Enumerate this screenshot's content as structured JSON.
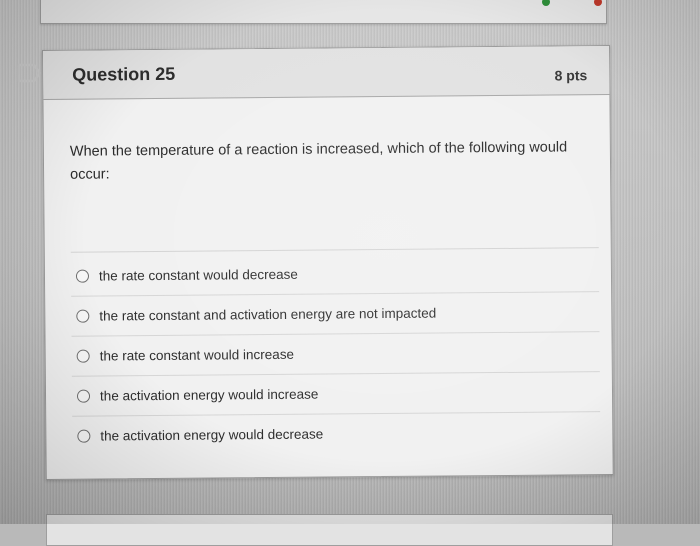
{
  "question": {
    "title": "Question 25",
    "points": "8 pts",
    "text": "When the temperature of a reaction is increased, which of the following would occur:",
    "answers": [
      {
        "label": "the rate constant would decrease"
      },
      {
        "label": "the rate constant and activation energy are not impacted"
      },
      {
        "label": "the rate constant would increase"
      },
      {
        "label": "the activation energy would increase"
      },
      {
        "label": "the activation energy would decrease"
      }
    ]
  },
  "colors": {
    "flag": "#c0c0c0",
    "dot_green": "#2f8f3a",
    "dot_red": "#c0392b"
  },
  "icons": {
    "flag": "flag-icon"
  }
}
